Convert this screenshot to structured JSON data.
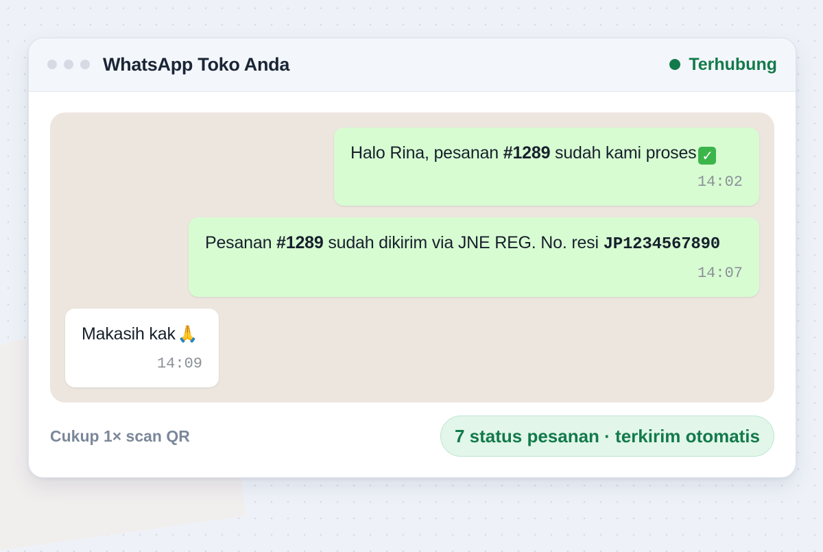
{
  "window": {
    "title": "WhatsApp Toko Anda",
    "status": "Terhubung"
  },
  "messages": [
    {
      "direction": "outgoing",
      "parts": [
        "Halo Rina, pesanan ",
        "#1289",
        " sudah kami proses"
      ],
      "emoji_icon": "check-mark-button-icon",
      "time": "14:02"
    },
    {
      "direction": "outgoing",
      "parts": [
        "Pesanan ",
        "#1289",
        " sudah dikirim via JNE REG. No. resi ",
        "JP1234567890"
      ],
      "time": "14:07"
    },
    {
      "direction": "incoming",
      "parts": [
        "Makasih kak"
      ],
      "emoji_icon": "folded-hands-icon",
      "time": "14:09"
    }
  ],
  "footer": {
    "note": "Cukup 1× scan QR",
    "badge": "7 status pesanan · terkirim otomatis"
  },
  "colors": {
    "accent_green": "#127a4a",
    "outgoing_bubble": "#d8fcd2",
    "incoming_bubble": "#ffffff",
    "chat_background": "#ece6df"
  }
}
